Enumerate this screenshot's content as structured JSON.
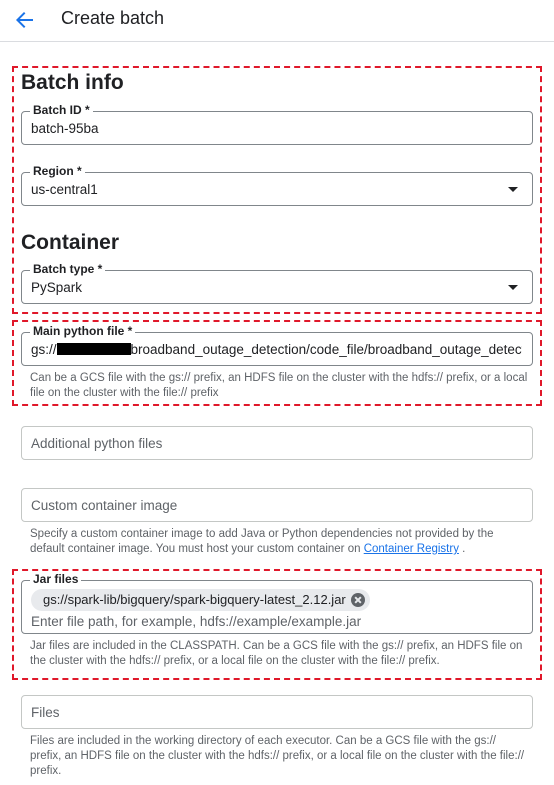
{
  "header": {
    "title": "Create batch",
    "back_icon": "arrow-back-icon"
  },
  "batch_info": {
    "title": "Batch info",
    "batch_id": {
      "label": "Batch ID *",
      "value": "batch-95ba"
    },
    "region": {
      "label": "Region *",
      "value": "us-central1"
    }
  },
  "container": {
    "title": "Container",
    "batch_type": {
      "label": "Batch type *",
      "value": "PySpark"
    },
    "main_python_file": {
      "label": "Main python file *",
      "value_prefix": "gs://",
      "value_suffix": "broadband_outage_detection/code_file/broadband_outage_detectio",
      "hint": "Can be a GCS file with the gs:// prefix, an HDFS file on the cluster with the hdfs:// prefix, or a local file on the cluster with the file:// prefix"
    },
    "additional_python_files": {
      "placeholder": "Additional python files"
    },
    "custom_container_image": {
      "placeholder": "Custom container image",
      "hint_before": "Specify a custom container image to add Java or Python dependencies not provided by the default container image. You must host your custom container on ",
      "hint_link": "Container Registry",
      "hint_after": " ."
    },
    "jar_files": {
      "label": "Jar files",
      "chip": "gs://spark-lib/bigquery/spark-bigquery-latest_2.12.jar",
      "placeholder": "Enter file path, for example, hdfs://example/example.jar",
      "hint": "Jar files are included in the CLASSPATH. Can be a GCS file with the gs:// prefix, an HDFS file on the cluster with the hdfs:// prefix, or a local file on the cluster with the file:// prefix."
    },
    "files": {
      "placeholder": "Files",
      "hint": "Files are included in the working directory of each executor. Can be a GCS file with the gs:// prefix, an HDFS file on the cluster with the hdfs:// prefix, or a local file on the cluster with the file:// prefix."
    }
  },
  "colors": {
    "accent": "#1a73e8",
    "highlight_box": "#e0182a",
    "text": "#202124",
    "hint": "#5f6368"
  }
}
